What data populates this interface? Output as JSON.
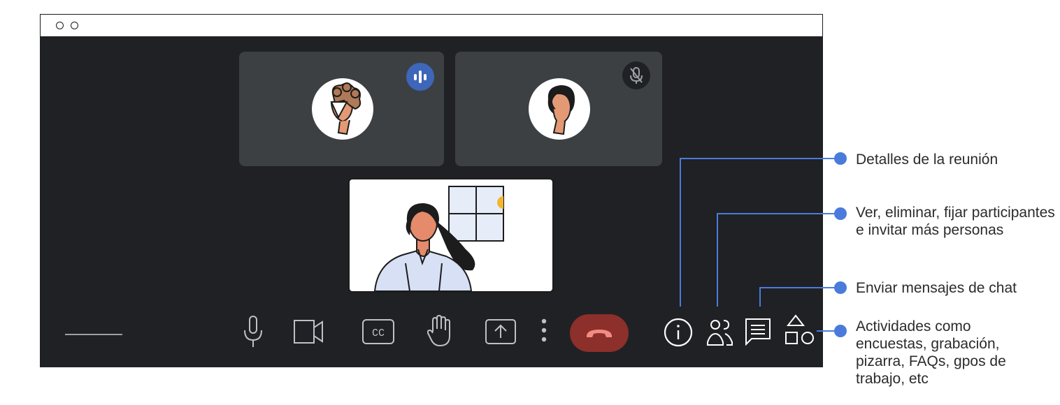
{
  "participants": [
    {
      "name_icon": "participant-1-avatar",
      "status": "speaking"
    },
    {
      "name_icon": "participant-2-avatar",
      "status": "muted"
    }
  ],
  "toolbar": {
    "icons": [
      "microphone-icon",
      "camera-icon",
      "captions-icon",
      "raise-hand-icon",
      "present-screen-icon",
      "more-options-icon",
      "end-call-icon"
    ],
    "captions_label": "CC"
  },
  "side_controls": [
    "info-icon",
    "people-icon",
    "chat-icon",
    "activities-icon"
  ],
  "callouts": {
    "meeting_details": "Detalles de la reunión",
    "participants": "Ver, eliminar, fijar participantes e invitar más personas",
    "chat": "Enviar mensajes de chat",
    "activities": "Actividades como encuestas, grabación, pizarra, FAQs, gpos de trabajo, etc"
  },
  "colors": {
    "meeting_bg": "#202124",
    "tile_bg": "#3c4043",
    "accent": "#4a7bdc",
    "speaking_badge": "#3e66b9",
    "hangup": "#8d2f2a"
  }
}
